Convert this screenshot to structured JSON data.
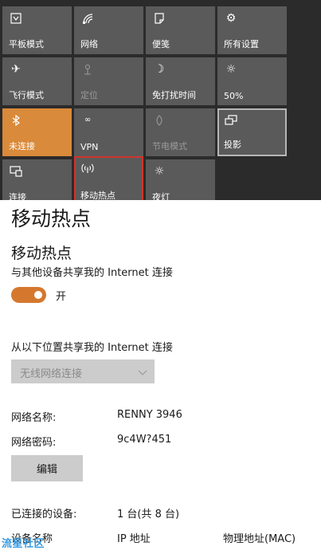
{
  "quick_actions": {
    "tiles": [
      {
        "label": "平板模式",
        "icon": "tablet-mode-icon",
        "state": "normal"
      },
      {
        "label": "网络",
        "icon": "network-icon",
        "state": "normal"
      },
      {
        "label": "便笺",
        "icon": "note-icon",
        "state": "normal"
      },
      {
        "label": "所有设置",
        "icon": "gear-icon",
        "state": "normal"
      },
      {
        "label": "飞行模式",
        "icon": "airplane-icon",
        "state": "normal"
      },
      {
        "label": "定位",
        "icon": "location-icon",
        "state": "disabled"
      },
      {
        "label": "免打扰时间",
        "icon": "moon-icon",
        "state": "normal"
      },
      {
        "label": "50%",
        "icon": "brightness-icon",
        "state": "normal"
      },
      {
        "label": "未连接",
        "icon": "bluetooth-icon",
        "state": "active"
      },
      {
        "label": "VPN",
        "icon": "vpn-icon",
        "state": "normal"
      },
      {
        "label": "节电模式",
        "icon": "battery-saver-icon",
        "state": "disabled"
      },
      {
        "label": "投影",
        "icon": "project-icon",
        "state": "focused"
      },
      {
        "label": "连接",
        "icon": "connect-icon",
        "state": "normal"
      },
      {
        "label": "移动热点",
        "icon": "hotspot-icon",
        "state": "highlighted"
      },
      {
        "label": "夜灯",
        "icon": "night-light-icon",
        "state": "normal"
      }
    ],
    "colors": {
      "tile": "#5a5a5a",
      "active": "#d98a3a",
      "highlight_border": "#d0342c",
      "background": "#2b2b2b"
    }
  },
  "hotspot": {
    "page_title": "移动热点",
    "section_title": "移动热点",
    "share_description": "与其他设备共享我的 Internet 连接",
    "toggle": {
      "on": true,
      "label": "开",
      "color": "#d4782e"
    },
    "share_from": {
      "label": "从以下位置共享我的 Internet 连接",
      "selected": "无线网络连接"
    },
    "network_name": {
      "label": "网络名称:",
      "value": "RENNY 3946"
    },
    "network_password": {
      "label": "网络密码:",
      "value": "9c4W?451"
    },
    "edit_button": "编辑",
    "connected_devices": {
      "label": "已连接的设备:",
      "value": "1 台(共 8 台)"
    },
    "device_table": {
      "columns": [
        "设备名称",
        "IP 地址",
        "物理地址(MAC)"
      ]
    }
  },
  "watermark": "流星社区"
}
